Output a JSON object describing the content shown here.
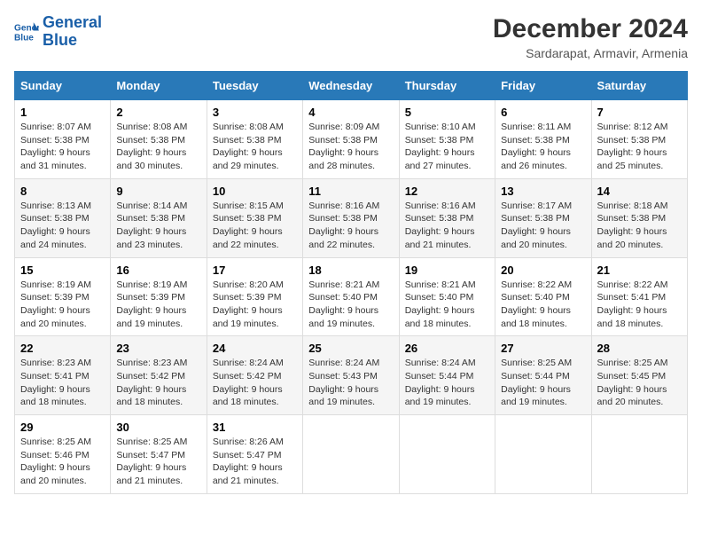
{
  "logo": {
    "line1": "General",
    "line2": "Blue"
  },
  "title": "December 2024",
  "subtitle": "Sardarapat, Armavir, Armenia",
  "days_header": [
    "Sunday",
    "Monday",
    "Tuesday",
    "Wednesday",
    "Thursday",
    "Friday",
    "Saturday"
  ],
  "weeks": [
    [
      {
        "day": "1",
        "sunrise": "8:07 AM",
        "sunset": "5:38 PM",
        "daylight": "9 hours and 31 minutes."
      },
      {
        "day": "2",
        "sunrise": "8:08 AM",
        "sunset": "5:38 PM",
        "daylight": "9 hours and 30 minutes."
      },
      {
        "day": "3",
        "sunrise": "8:08 AM",
        "sunset": "5:38 PM",
        "daylight": "9 hours and 29 minutes."
      },
      {
        "day": "4",
        "sunrise": "8:09 AM",
        "sunset": "5:38 PM",
        "daylight": "9 hours and 28 minutes."
      },
      {
        "day": "5",
        "sunrise": "8:10 AM",
        "sunset": "5:38 PM",
        "daylight": "9 hours and 27 minutes."
      },
      {
        "day": "6",
        "sunrise": "8:11 AM",
        "sunset": "5:38 PM",
        "daylight": "9 hours and 26 minutes."
      },
      {
        "day": "7",
        "sunrise": "8:12 AM",
        "sunset": "5:38 PM",
        "daylight": "9 hours and 25 minutes."
      }
    ],
    [
      {
        "day": "8",
        "sunrise": "8:13 AM",
        "sunset": "5:38 PM",
        "daylight": "9 hours and 24 minutes."
      },
      {
        "day": "9",
        "sunrise": "8:14 AM",
        "sunset": "5:38 PM",
        "daylight": "9 hours and 23 minutes."
      },
      {
        "day": "10",
        "sunrise": "8:15 AM",
        "sunset": "5:38 PM",
        "daylight": "9 hours and 22 minutes."
      },
      {
        "day": "11",
        "sunrise": "8:16 AM",
        "sunset": "5:38 PM",
        "daylight": "9 hours and 22 minutes."
      },
      {
        "day": "12",
        "sunrise": "8:16 AM",
        "sunset": "5:38 PM",
        "daylight": "9 hours and 21 minutes."
      },
      {
        "day": "13",
        "sunrise": "8:17 AM",
        "sunset": "5:38 PM",
        "daylight": "9 hours and 20 minutes."
      },
      {
        "day": "14",
        "sunrise": "8:18 AM",
        "sunset": "5:38 PM",
        "daylight": "9 hours and 20 minutes."
      }
    ],
    [
      {
        "day": "15",
        "sunrise": "8:19 AM",
        "sunset": "5:39 PM",
        "daylight": "9 hours and 20 minutes."
      },
      {
        "day": "16",
        "sunrise": "8:19 AM",
        "sunset": "5:39 PM",
        "daylight": "9 hours and 19 minutes."
      },
      {
        "day": "17",
        "sunrise": "8:20 AM",
        "sunset": "5:39 PM",
        "daylight": "9 hours and 19 minutes."
      },
      {
        "day": "18",
        "sunrise": "8:21 AM",
        "sunset": "5:40 PM",
        "daylight": "9 hours and 19 minutes."
      },
      {
        "day": "19",
        "sunrise": "8:21 AM",
        "sunset": "5:40 PM",
        "daylight": "9 hours and 18 minutes."
      },
      {
        "day": "20",
        "sunrise": "8:22 AM",
        "sunset": "5:40 PM",
        "daylight": "9 hours and 18 minutes."
      },
      {
        "day": "21",
        "sunrise": "8:22 AM",
        "sunset": "5:41 PM",
        "daylight": "9 hours and 18 minutes."
      }
    ],
    [
      {
        "day": "22",
        "sunrise": "8:23 AM",
        "sunset": "5:41 PM",
        "daylight": "9 hours and 18 minutes."
      },
      {
        "day": "23",
        "sunrise": "8:23 AM",
        "sunset": "5:42 PM",
        "daylight": "9 hours and 18 minutes."
      },
      {
        "day": "24",
        "sunrise": "8:24 AM",
        "sunset": "5:42 PM",
        "daylight": "9 hours and 18 minutes."
      },
      {
        "day": "25",
        "sunrise": "8:24 AM",
        "sunset": "5:43 PM",
        "daylight": "9 hours and 19 minutes."
      },
      {
        "day": "26",
        "sunrise": "8:24 AM",
        "sunset": "5:44 PM",
        "daylight": "9 hours and 19 minutes."
      },
      {
        "day": "27",
        "sunrise": "8:25 AM",
        "sunset": "5:44 PM",
        "daylight": "9 hours and 19 minutes."
      },
      {
        "day": "28",
        "sunrise": "8:25 AM",
        "sunset": "5:45 PM",
        "daylight": "9 hours and 20 minutes."
      }
    ],
    [
      {
        "day": "29",
        "sunrise": "8:25 AM",
        "sunset": "5:46 PM",
        "daylight": "9 hours and 20 minutes."
      },
      {
        "day": "30",
        "sunrise": "8:25 AM",
        "sunset": "5:47 PM",
        "daylight": "9 hours and 21 minutes."
      },
      {
        "day": "31",
        "sunrise": "8:26 AM",
        "sunset": "5:47 PM",
        "daylight": "9 hours and 21 minutes."
      },
      null,
      null,
      null,
      null
    ]
  ],
  "labels": {
    "sunrise": "Sunrise:",
    "sunset": "Sunset:",
    "daylight": "Daylight:"
  }
}
